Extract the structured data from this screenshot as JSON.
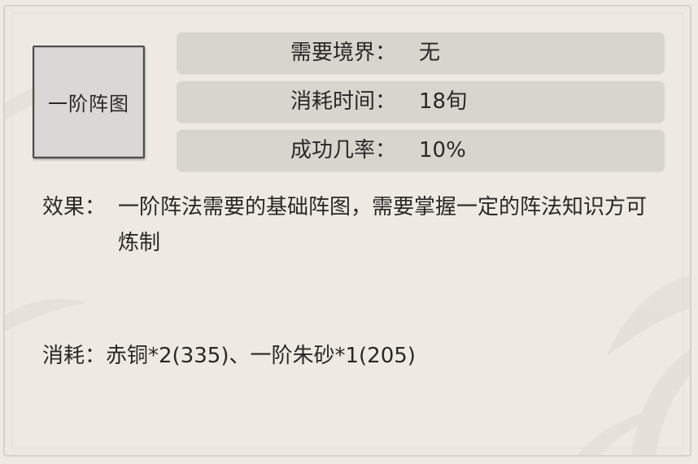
{
  "item": {
    "name": "一阶阵图"
  },
  "stats": [
    {
      "label": "需要境界：",
      "value": "无"
    },
    {
      "label": "消耗时间：",
      "value": "18旬"
    },
    {
      "label": "成功几率：",
      "value": "10%"
    }
  ],
  "effect": {
    "label": "效果：",
    "text": "一阶阵法需要的基础阵图，需要掌握一定的阵法知识方可炼制"
  },
  "cost": {
    "label": "消耗：",
    "text": "赤铜*2(335)、一阶朱砂*1(205)"
  }
}
